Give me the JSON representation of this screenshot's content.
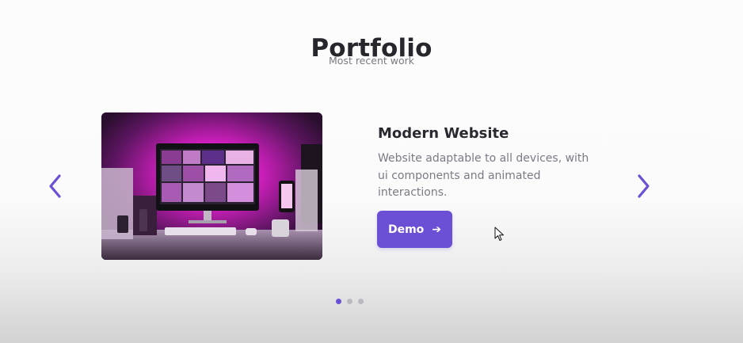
{
  "header": {
    "title": "Portfolio",
    "subtitle": "Most recent work"
  },
  "project": {
    "title": "Modern Website",
    "description": "Website adaptable to all devices, with ui components and animated interactions.",
    "button_label": "Demo",
    "button_icon": "arrow-right-icon"
  },
  "carousel": {
    "prev_icon": "chevron-left-icon",
    "next_icon": "chevron-right-icon",
    "pagination": {
      "total": 3,
      "active_index": 0
    }
  },
  "colors": {
    "accent": "#6b4fd4",
    "title": "#27262c",
    "text_muted": "#7b7a84",
    "dot_inactive": "#b9b9c0"
  }
}
